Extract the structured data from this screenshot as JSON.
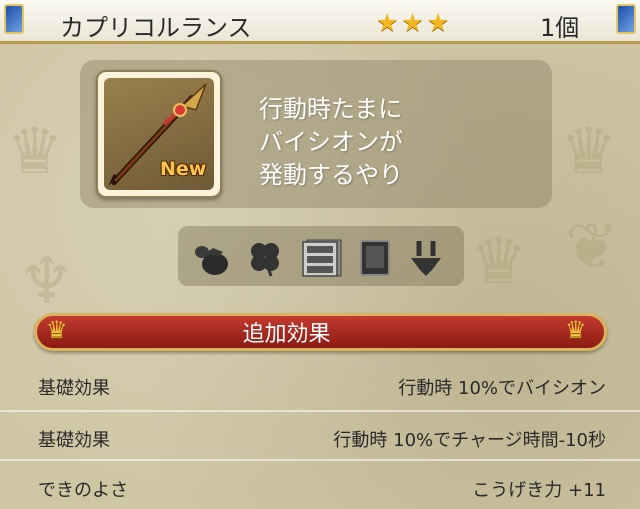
{
  "header": {
    "item_name": "カプリコルランス",
    "rarity_stars": 3,
    "rarity_display": "★★★",
    "quantity": "1個"
  },
  "item_card": {
    "badge": "New",
    "description_lines": [
      "行動時たまに",
      "バイシオンが",
      "発動するやり"
    ]
  },
  "category_tabs": [
    {
      "icon": "bag-icon"
    },
    {
      "icon": "clover-icon"
    },
    {
      "icon": "dresser-icon"
    },
    {
      "icon": "book-icon"
    },
    {
      "icon": "trident-icon"
    }
  ],
  "effects_section": {
    "title": "追加効果",
    "rows": [
      {
        "label": "基礎効果",
        "value": "行動時  10%でバイシオン"
      },
      {
        "label": "基礎効果",
        "value": "行動時  10%でチャージ時間-10秒"
      },
      {
        "label": "できのよさ",
        "value": "こうげき力  +11"
      }
    ]
  },
  "colors": {
    "banner_red": "#a52a20",
    "star_gold": "#f1b620",
    "frame_gold": "#dbb35a",
    "panel_background": "#cfc6a4"
  }
}
